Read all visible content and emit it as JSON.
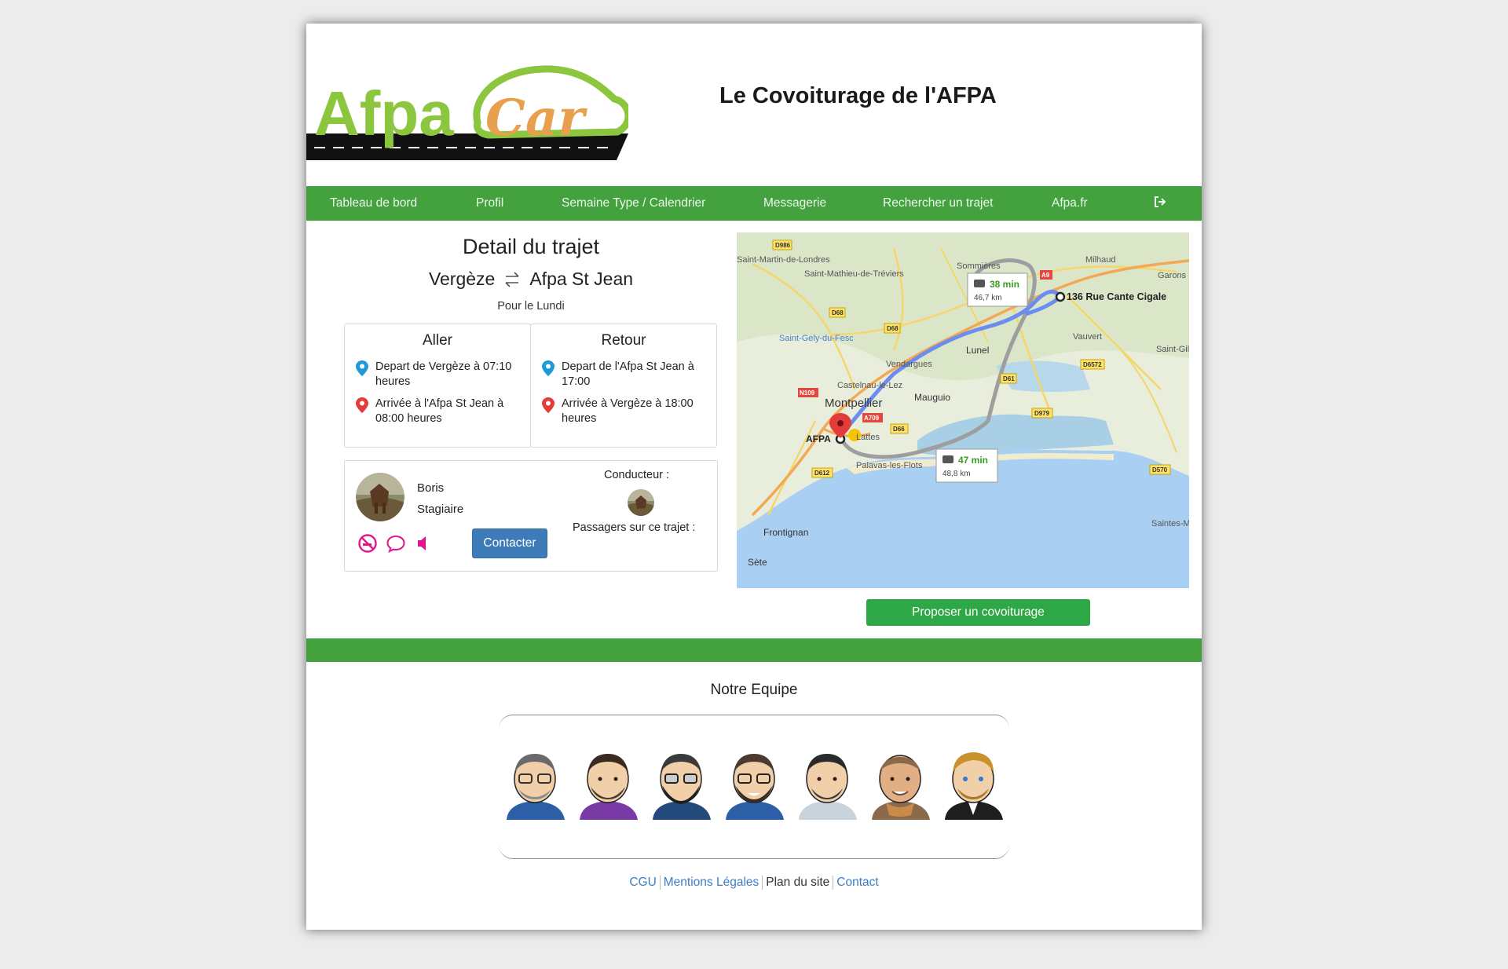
{
  "app": {
    "logo_primary": "Afpa",
    "logo_secondary": "Car",
    "title": "Le Covoiturage de l'AFPA"
  },
  "nav": {
    "items": [
      "Tableau de bord",
      "Profil",
      "Semaine Type / Calendrier",
      "Messagerie",
      "Rechercher un trajet",
      "Afpa.fr"
    ],
    "logout_icon": "sign-out-icon"
  },
  "detail": {
    "title": "Detail du trajet",
    "from": "Vergèze",
    "to": "Afpa St Jean",
    "swap_icon": "exchange-icon",
    "day": "Pour le Lundi",
    "aller": {
      "title": "Aller",
      "departure": "Depart de Vergèze à 07:10 heures",
      "arrival": "Arrivée à l'Afpa St Jean à 08:00 heures"
    },
    "retour": {
      "title": "Retour",
      "departure": "Depart de l'Afpa St Jean à 17:00",
      "arrival": "Arrivée à Vergèze à 18:00 heures"
    },
    "colors": {
      "departure_pin": "#1e9bd7",
      "arrival_pin": "#e43b3b"
    }
  },
  "driver": {
    "name": "Boris",
    "role": "Stagiaire",
    "contact_label": "Contacter",
    "driver_label": "Conducteur :",
    "passengers_label": "Passagers sur ce trajet :",
    "preference_icons": [
      "no-smoking-icon",
      "chat-icon",
      "music-icon"
    ],
    "pref_color": "#e0168c"
  },
  "map": {
    "route_1": {
      "duration": "38 min",
      "distance": "46,7 km"
    },
    "route_2": {
      "duration": "47 min",
      "distance": "48,8 km"
    },
    "destination_label": "136 Rue Cante Cigale",
    "origin_label": "AFPA",
    "places": [
      "Saint-Martin-de-Londres",
      "Saint-Mathieu-de-Tréviers",
      "Sommières",
      "Milhaud",
      "Garons",
      "Saint-Gely-du-Fesc",
      "Vauvert",
      "Saint-Gil",
      "Vendargues",
      "Lunel",
      "Castelnau-le-Lez",
      "Montpellier",
      "Mauguio",
      "Lattes",
      "Palavas-les-Flots",
      "Frontignan",
      "Sète",
      "Saintes-Maries-"
    ],
    "roads": [
      "D986",
      "D68",
      "D68",
      "A9",
      "A9",
      "D6572",
      "N109",
      "A709",
      "D66",
      "D61",
      "D979",
      "D612",
      "D570"
    ]
  },
  "propose_label": "Proposer un covoiturage",
  "team": {
    "title": "Notre Equipe",
    "members": [
      "avatar-1",
      "avatar-2",
      "avatar-3",
      "avatar-4",
      "avatar-5",
      "avatar-6",
      "avatar-7"
    ]
  },
  "footer": {
    "cgu": "CGU",
    "mentions": "Mentions Légales",
    "plan": "Plan du site",
    "contact": "Contact"
  },
  "colors": {
    "brand_green": "#43a23e",
    "button_blue": "#3d7cb8",
    "button_green": "#2ea846",
    "logo_green": "#8cc63f",
    "logo_orange": "#e8a04e"
  }
}
